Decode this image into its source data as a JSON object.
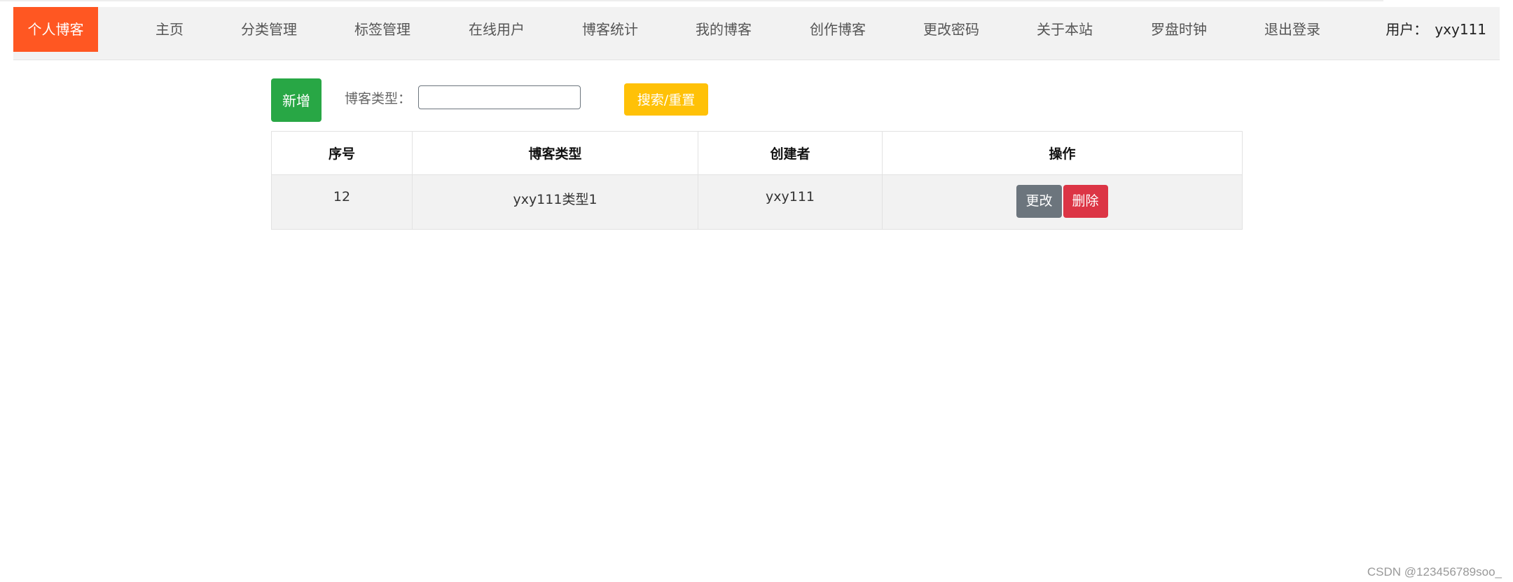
{
  "nav": {
    "brand": "个人博客",
    "items": [
      "主页",
      "分类管理",
      "标签管理",
      "在线用户",
      "博客统计",
      "我的博客",
      "创作博客",
      "更改密码",
      "关于本站",
      "罗盘时钟",
      "退出登录"
    ],
    "user_label": "用户：",
    "user_name": "yxy111"
  },
  "toolbar": {
    "add_label": "新增",
    "filter_label": "博客类型：",
    "filter_value": "",
    "filter_placeholder": "",
    "search_label": "搜索/重置"
  },
  "table": {
    "headers": [
      "序号",
      "博客类型",
      "创建者",
      "操作"
    ],
    "rows": [
      {
        "id": "12",
        "type": "yxy111类型1",
        "creator": "yxy111",
        "edit_label": "更改",
        "delete_label": "删除"
      }
    ]
  },
  "watermark": "CSDN @123456789soo_",
  "colors": {
    "brand": "#ff5722",
    "add_button": "#28a745",
    "search_button": "#ffc107",
    "edit_button": "#6c757d",
    "delete_button": "#dc3545"
  }
}
